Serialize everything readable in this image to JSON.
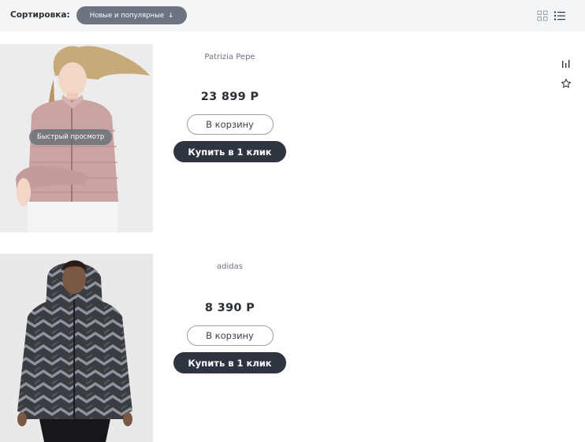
{
  "toolbar": {
    "sort_label": "Сортировка:",
    "sort_value": "Новые и популярные",
    "sort_arrow": "↓"
  },
  "side_icons": [
    "compare-icon",
    "favorite-icon"
  ],
  "products": [
    {
      "brand": "Patrizia Pepe",
      "price": "23 899 Р",
      "cart_label": "В корзину",
      "buy_label": "Купить в 1 клик",
      "quick_view_label": "Быстрый просмотр"
    },
    {
      "brand": "adidas",
      "price": "8 390 Р",
      "cart_label": "В корзину",
      "buy_label": "Купить в 1 клик"
    }
  ]
}
